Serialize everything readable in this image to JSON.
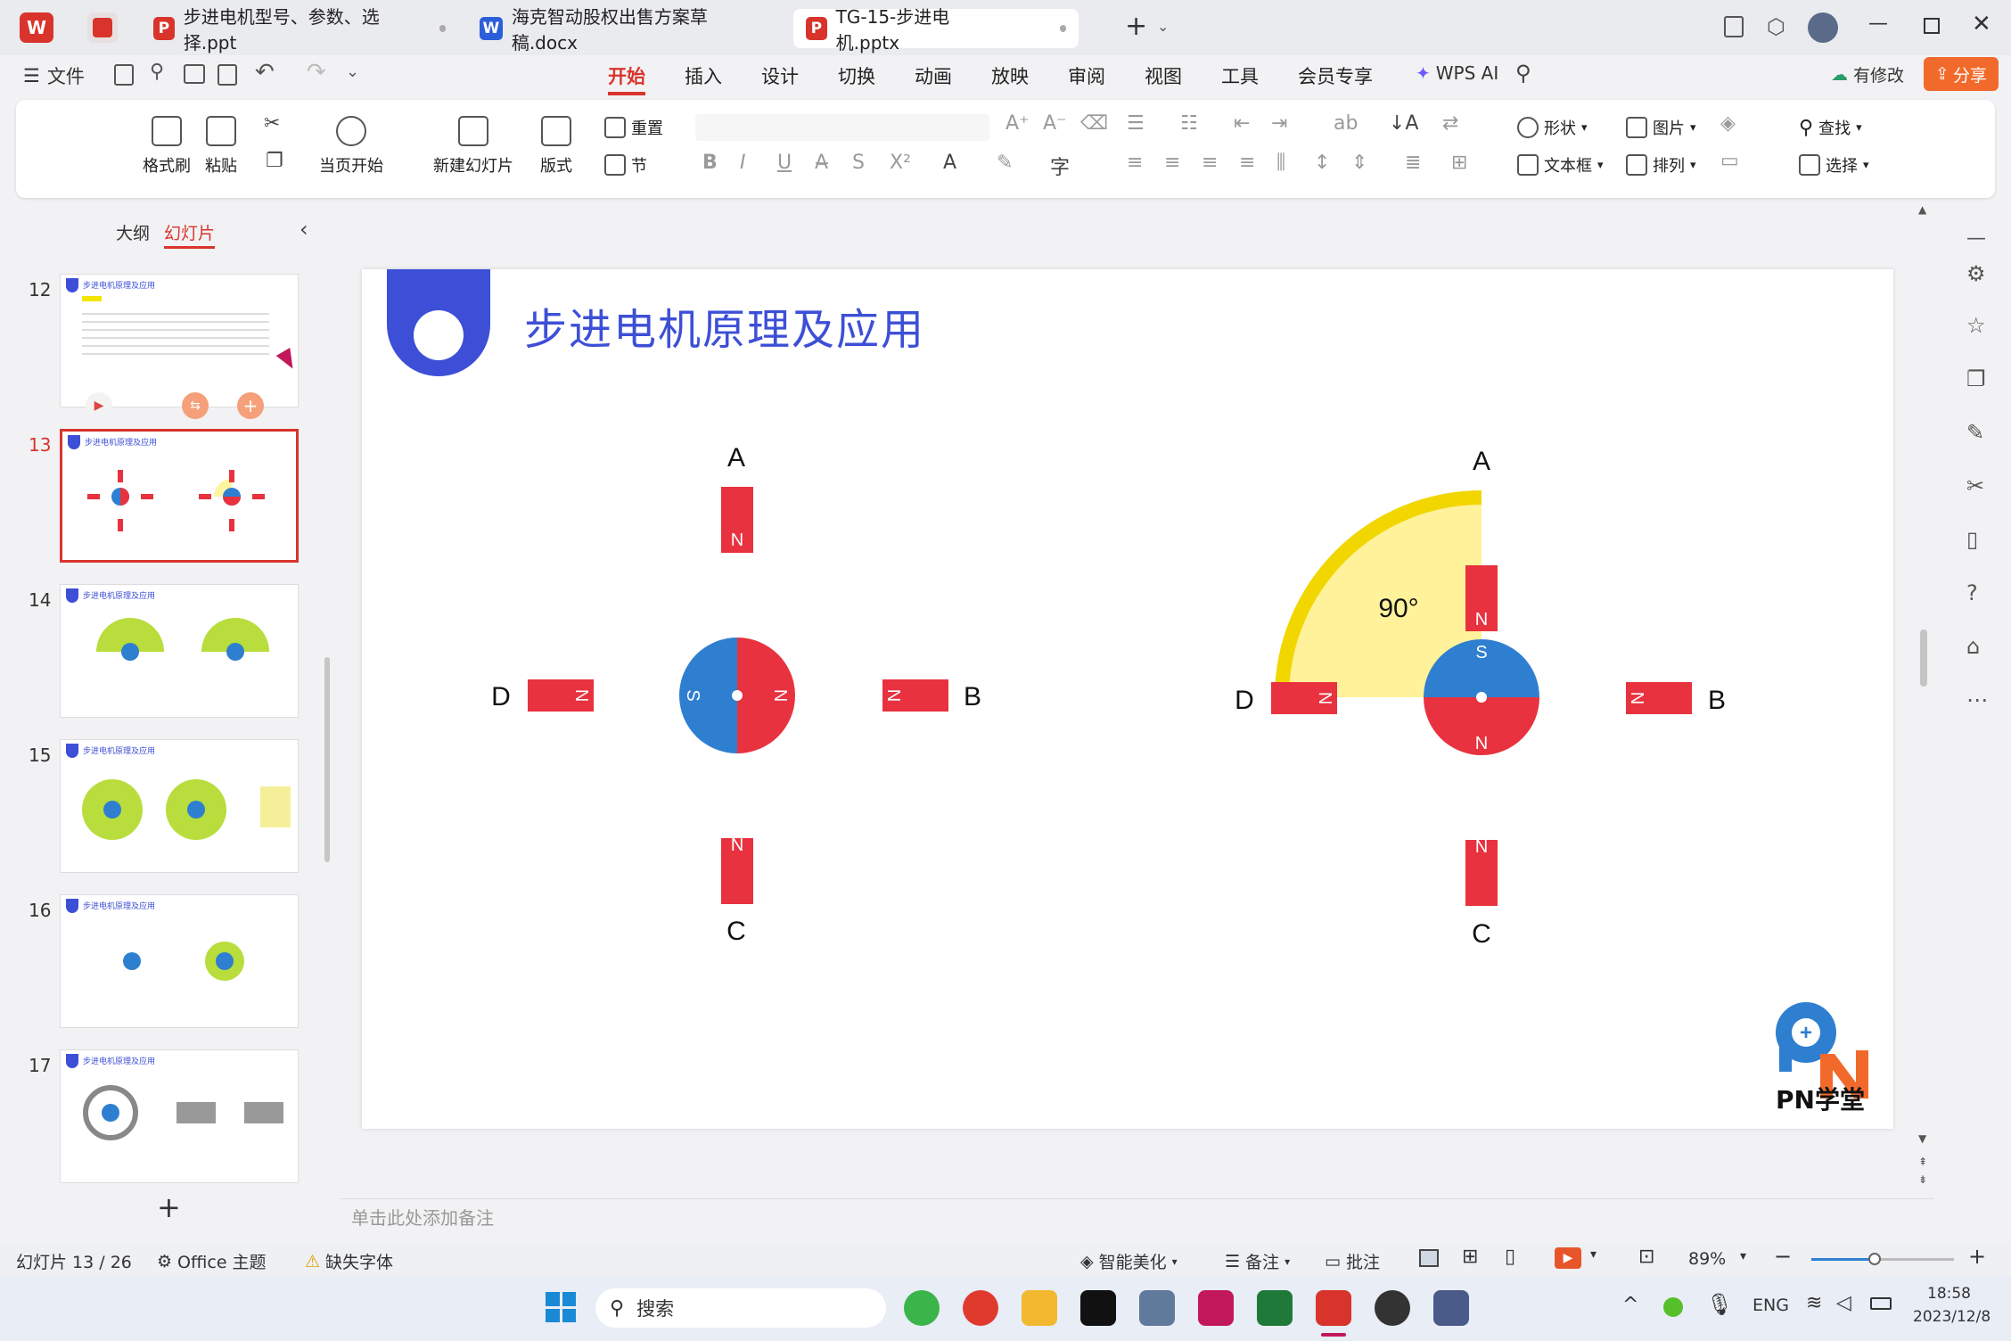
{
  "tabs": [
    {
      "label": "步进电机型号、参数、选择.ppt",
      "icon": "P",
      "color": "#d9342b"
    },
    {
      "label": "海克智动股权出售方案草稿.docx",
      "icon": "W",
      "color": "#2b5fd9"
    },
    {
      "label": "TG-15-步进电机.pptx",
      "icon": "P",
      "color": "#d9342b"
    }
  ],
  "menu": {
    "file": "文件",
    "items": [
      "开始",
      "插入",
      "设计",
      "切换",
      "动画",
      "放映",
      "审阅",
      "视图",
      "工具",
      "会员专享"
    ],
    "wps_ai": "WPS AI",
    "modified": "有修改",
    "share": "分享"
  },
  "ribbon": {
    "format_painter": "格式刷",
    "paste": "粘贴",
    "play_from_current": "当页开始",
    "new_slide": "新建幻灯片",
    "layout": "版式",
    "reset": "重置",
    "section": "节",
    "shape": "形状",
    "picture": "图片",
    "find": "查找",
    "textbox": "文本框",
    "arrange": "排列",
    "select": "选择"
  },
  "panel": {
    "outline_tab": "大纲",
    "slides_tab": "幻灯片",
    "add": "+"
  },
  "thumbnails": [
    {
      "num": "12",
      "title": "步进电机原理及应用"
    },
    {
      "num": "13",
      "title": "步进电机原理及应用"
    },
    {
      "num": "14",
      "title": "步进电机原理及应用"
    },
    {
      "num": "15",
      "title": "步进电机原理及应用"
    },
    {
      "num": "16",
      "title": "步进电机原理及应用"
    },
    {
      "num": "17",
      "title": "步进电机原理及应用"
    }
  ],
  "slide": {
    "title": "步进电机原理及应用",
    "left_diagram": {
      "labels": {
        "top": "A",
        "right": "B",
        "bottom": "C",
        "left": "D"
      },
      "pole_letter": "N",
      "rotor_left": "S",
      "rotor_right": "N"
    },
    "right_diagram": {
      "labels": {
        "top": "A",
        "right": "B",
        "bottom": "C",
        "left": "D"
      },
      "pole_letter": "N",
      "rotor_top": "S",
      "rotor_bottom": "N",
      "angle": "90°"
    },
    "logo_text": "PN学堂"
  },
  "notes_placeholder": "单击此处添加备注",
  "status": {
    "slide_counter": "幻灯片 13 / 26",
    "theme": "Office 主题",
    "missing_font": "缺失字体",
    "beautify": "智能美化",
    "notes": "备注",
    "comment": "批注",
    "zoom": "89%"
  },
  "taskbar": {
    "search": "搜索",
    "lang": "ENG",
    "time": "18:58",
    "date": "2023/12/8"
  },
  "colors": {
    "accent": "#d9342b",
    "slide_title": "#3d4fd6",
    "magnet_red": "#e8323f",
    "rotor_blue": "#2f7fd0",
    "arc_yellow": "#f2d600"
  }
}
